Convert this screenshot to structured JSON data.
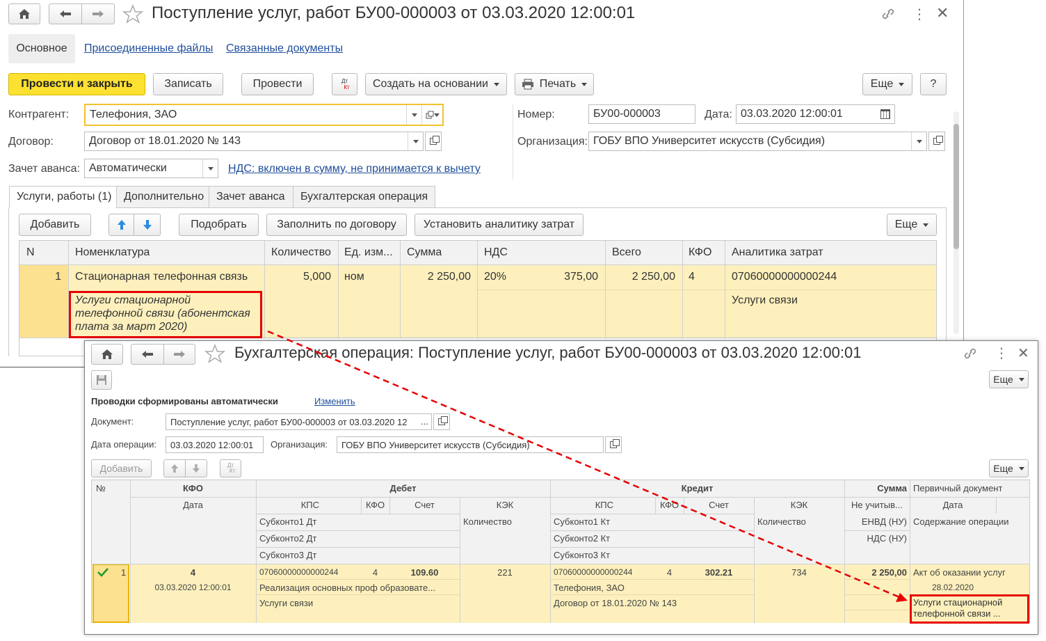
{
  "doc": {
    "title": "Поступление услуг, работ БУ00-000003 от 03.03.2020 12:00:01",
    "nav_tabs": [
      "Основное",
      "Присоединенные файлы",
      "Связанные документы"
    ],
    "toolbar": {
      "post_close": "Провести и закрыть",
      "save": "Записать",
      "post": "Провести",
      "dtkt_top": "Дт",
      "dtkt_bottom": "Кт",
      "create_based": "Создать на основании",
      "print": "Печать",
      "more": "Еще",
      "help": "?"
    },
    "fields": {
      "counterparty_label": "Контрагент:",
      "counterparty_value": "Телефония, ЗАО",
      "contract_label": "Договор:",
      "contract_value": "Договор от 18.01.2020 № 143",
      "advance_label": "Зачет аванса:",
      "advance_value": "Автоматически",
      "vat_link": "НДС: включен в сумму, не принимается к вычету",
      "number_label": "Номер:",
      "number_value": "БУ00-000003",
      "date_label": "Дата:",
      "date_value": "03.03.2020 12:00:01",
      "org_label": "Организация:",
      "org_value": "ГОБУ ВПО Университет искусств (Субсидия)"
    },
    "tabs": [
      "Услуги, работы (1)",
      "Дополнительно",
      "Зачет аванса",
      "Бухгалтерская операция"
    ],
    "table_toolbar": {
      "add": "Добавить",
      "pick": "Подобрать",
      "fill": "Заполнить по договору",
      "analytics": "Установить аналитику затрат",
      "more": "Еще"
    },
    "columns": [
      "N",
      "Номенклатура",
      "Количество",
      "Ед. изм...",
      "Сумма",
      "НДС",
      "Всего",
      "КФО",
      "Аналитика затрат"
    ],
    "row": {
      "n": "1",
      "item": "Стационарная телефонная связь",
      "item_desc": "Услуги стационарной телефонной связи (абонентская плата за март 2020)",
      "qty": "5,000",
      "unit": "ном",
      "sum": "2 250,00",
      "vat_rate": "20%",
      "vat_sum": "375,00",
      "total": "2 250,00",
      "kfo": "4",
      "analytics_code": "07060000000000244",
      "analytics_name": "Услуги связи"
    }
  },
  "op": {
    "title": "Бухгалтерская операция: Поступление услуг, работ БУ00-000003 от 03.03.2020 12:00:01",
    "more": "Еще",
    "auto_text": "Проводки сформированы автоматически",
    "change_link": "Изменить",
    "document_label": "Документ:",
    "document_value": "Поступление услуг, работ БУ00-000003 от 03.03.2020 12",
    "document_dots": "...",
    "op_date_label": "Дата операции:",
    "op_date_value": "03.03.2020 12:00:01",
    "org_label": "Организация:",
    "org_value": "ГОБУ ВПО Университет искусств (Субсидия)",
    "add": "Добавить",
    "dtkt_top": "Дт",
    "dtkt_bottom": "Кт",
    "grid": {
      "h_no": "№",
      "h_kfo": "КФО",
      "h_date": "Дата",
      "h_debit": "Дебет",
      "h_credit": "Кредит",
      "h_sum": "Сумма",
      "h_primary": "Первичный документ",
      "h_kps": "КПС",
      "h_kfo2": "КФО",
      "h_account": "Счет",
      "h_kek": "КЭК",
      "h_qty": "Количество",
      "h_sub1_dt": "Субконто1 Дт",
      "h_sub2_dt": "Субконто2 Дт",
      "h_sub3_dt": "Субконто3 Дт",
      "h_sub1_kt": "Субконто1 Кт",
      "h_sub2_kt": "Субконто2 Кт",
      "h_sub3_kt": "Субконто3 Кт",
      "h_not_acc": "Не учитыв...",
      "h_envd": "ЕНВД (НУ)",
      "h_nds": "НДС (НУ)",
      "h_pdate": "Дата",
      "h_content": "Содержание операции"
    },
    "entry": {
      "n": "1",
      "kfo": "4",
      "date": "03.03.2020 12:00:01",
      "dt_kps": "07060000000000244",
      "dt_kfo": "4",
      "dt_account": "109.60",
      "dt_kek": "221",
      "dt_sub1": "Реализация основных проф образовате...",
      "dt_sub2": "Услуги связи",
      "kt_kps": "07060000000000244",
      "kt_kfo": "4",
      "kt_account": "302.21",
      "kt_kek": "734",
      "kt_sub1": "Телефония, ЗАО",
      "kt_sub2": "Договор от 18.01.2020 № 143",
      "sum": "2 250,00",
      "primary_doc": "Акт об оказании услуг",
      "primary_date": "28.02.2020",
      "content": "Услуги стационарной телефонной связи ..."
    }
  },
  "colors": {
    "accent_yellow": "#fde131",
    "row_highlight": "#fdf0bd",
    "annotation_red": "#e60000",
    "link_blue": "#1f4e9c"
  }
}
